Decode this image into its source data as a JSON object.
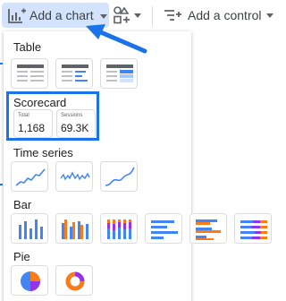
{
  "toolbar": {
    "add_chart_label": "Add a chart",
    "add_control_label": "Add a control",
    "add_chart_icon": "chart-plus-icon",
    "components_icon": "components-plus-icon",
    "control_icon": "filter-plus-icon"
  },
  "menu": {
    "sections": {
      "table": "Table",
      "scorecard": "Scorecard",
      "time_series": "Time series",
      "bar": "Bar",
      "pie": "Pie"
    },
    "scorecards": [
      {
        "name": "Total",
        "value": "1,168"
      },
      {
        "name": "Sessions",
        "value": "69.3K"
      }
    ]
  },
  "colors": {
    "accent": "#1a73e8",
    "highlight_bg": "#d3e3fd",
    "chart_blue": "#4285f4",
    "chart_orange": "#fa7b17",
    "chart_purple": "#9334e6"
  }
}
